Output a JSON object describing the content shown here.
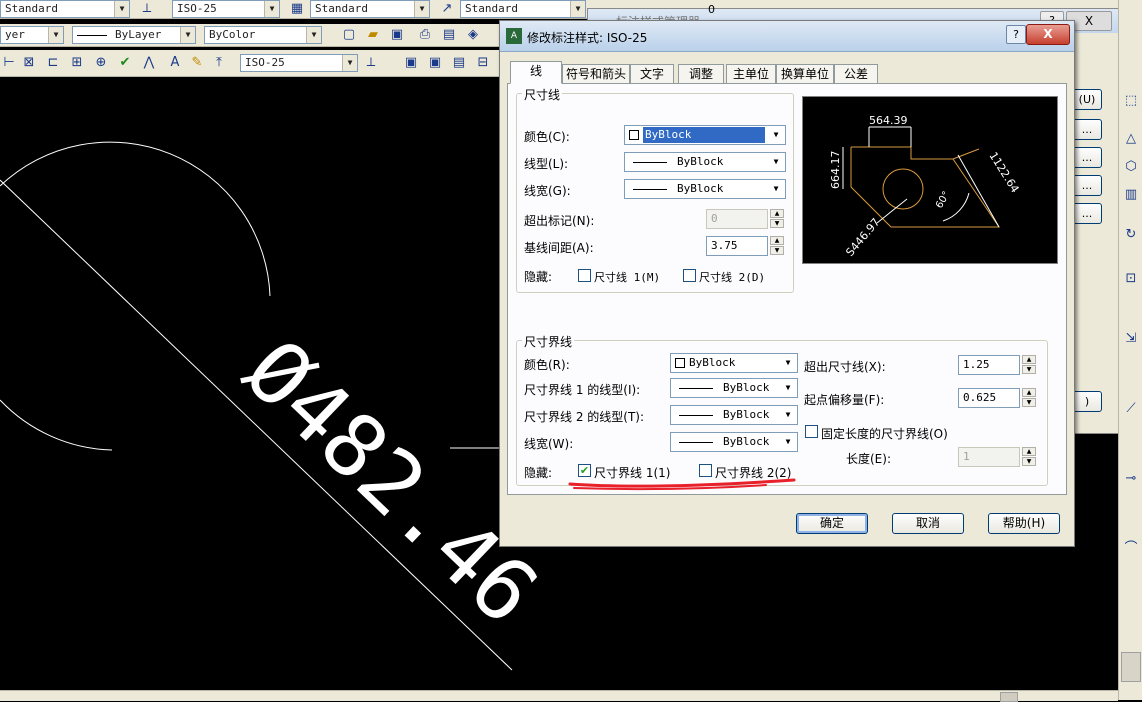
{
  "toolbar": {
    "row1": {
      "text_style": "Standard",
      "dim_style": "ISO-25",
      "table_style": "Standard",
      "multileader_style": "Standard"
    },
    "row2": {
      "layer": "yer",
      "linetype": "ByLayer",
      "color": "ByColor"
    },
    "row3": {
      "dim_style": "ISO-25"
    }
  },
  "canvas": {
    "dimension_text": "Ø482.46"
  },
  "bg_window": {
    "title_partial": "标注样式管理器",
    "number": "0",
    "buttons": [
      "(U)",
      "...",
      "...",
      "...",
      "...",
      ")"
    ]
  },
  "dialog": {
    "title": "修改标注样式: ISO-25",
    "help_icon": "?",
    "close_icon": "X",
    "tabs": [
      "线",
      "符号和箭头",
      "文字",
      "调整",
      "主单位",
      "换算单位",
      "公差"
    ],
    "active_tab": "线",
    "dim_lines": {
      "group_title": "尺寸线",
      "color_label": "颜色(C):",
      "color_value": "ByBlock",
      "linetype_label": "线型(L):",
      "linetype_value": "ByBlock",
      "lineweight_label": "线宽(G):",
      "lineweight_value": "ByBlock",
      "extend_ticks_label": "超出标记(N):",
      "extend_ticks_value": "0",
      "baseline_spacing_label": "基线间距(A):",
      "baseline_spacing_value": "3.75",
      "suppress_label": "隐藏:",
      "suppress_1_label": "尺寸线 1(M)",
      "suppress_1_checked": false,
      "suppress_2_label": "尺寸线 2(D)",
      "suppress_2_checked": false
    },
    "preview": {
      "top_dim": "564.39",
      "left_dim": "664.17",
      "right_dim": "1122.64",
      "diag_dim": "S446.97",
      "angle_dim": "60°"
    },
    "ext_lines": {
      "group_title": "尺寸界线",
      "color_label": "颜色(R):",
      "color_value": "ByBlock",
      "ext1_linetype_label": "尺寸界线 1 的线型(I):",
      "ext1_linetype_value": "ByBlock",
      "ext2_linetype_label": "尺寸界线 2 的线型(T):",
      "ext2_linetype_value": "ByBlock",
      "lineweight_label": "线宽(W):",
      "lineweight_value": "ByBlock",
      "suppress_label": "隐藏:",
      "suppress_1_label": "尺寸界线 1(1)",
      "suppress_1_checked": true,
      "suppress_2_label": "尺寸界线 2(2)",
      "suppress_2_checked": false,
      "extend_beyond_label": "超出尺寸线(X):",
      "extend_beyond_value": "1.25",
      "offset_label": "起点偏移量(F):",
      "offset_value": "0.625",
      "fixed_length_label": "固定长度的尺寸界线(O)",
      "fixed_length_checked": false,
      "length_label": "长度(E):",
      "length_value": "1"
    },
    "buttons": {
      "ok": "确定",
      "cancel": "取消",
      "help": "帮助(H)"
    }
  },
  "colors": {
    "annotation_red": "#e8202a",
    "preview_orange": "#d99a3e",
    "cad_white": "#ffffff"
  }
}
